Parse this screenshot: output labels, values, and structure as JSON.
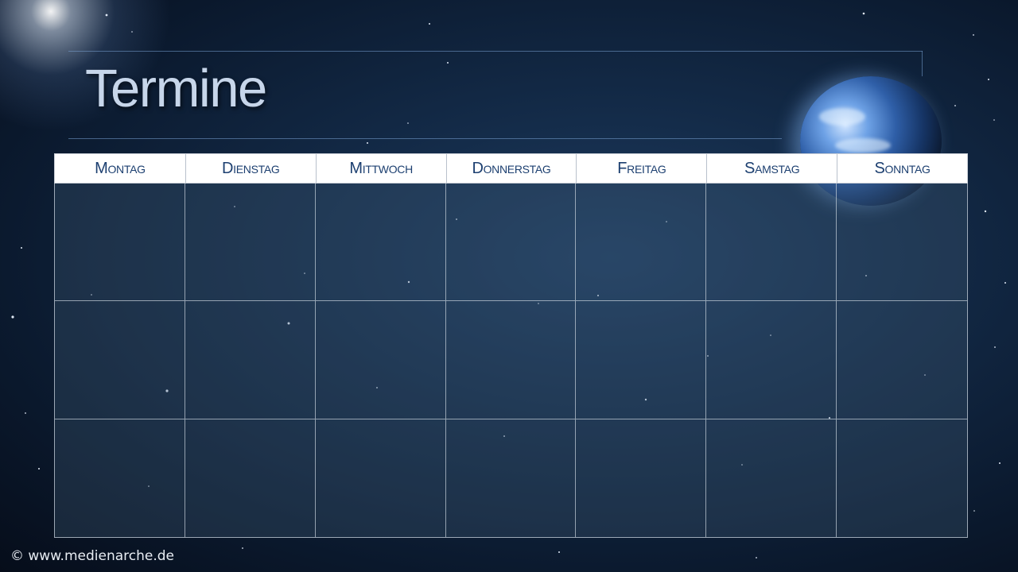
{
  "slide": {
    "title": "Termine"
  },
  "calendar": {
    "weekdays": [
      "Montag",
      "Dienstag",
      "Mittwoch",
      "Donnerstag",
      "Freitag",
      "Samstag",
      "Sonntag"
    ],
    "rows": 3
  },
  "footer": {
    "copyright": "© www.medienarche.de"
  },
  "colors": {
    "title_text": "#c7d6ea",
    "header_text": "#1c3f70",
    "header_background": "#ffffff",
    "background": "#0b1a2f"
  },
  "icons": {
    "planet": "earth-image",
    "sun_glare": "sun-glare"
  }
}
